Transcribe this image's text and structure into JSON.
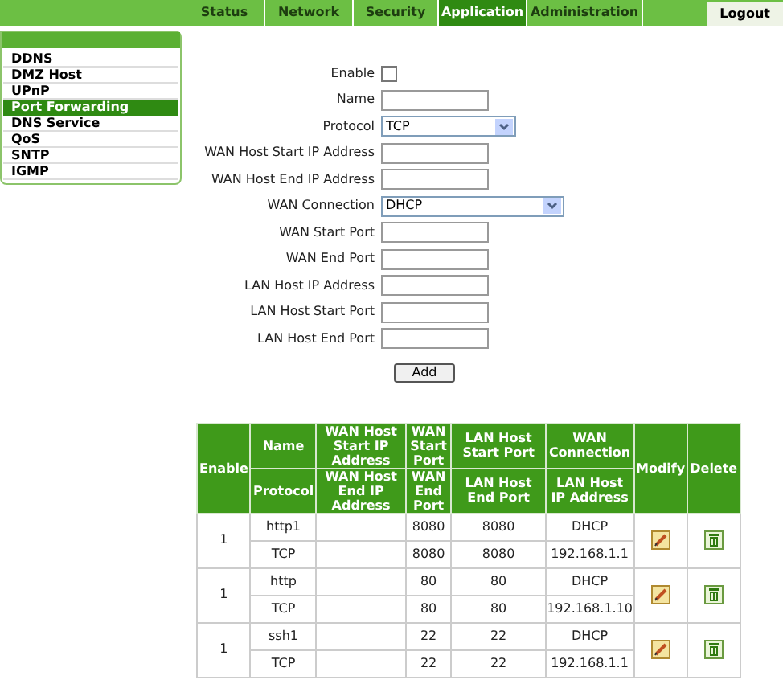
{
  "nav": {
    "tabs": [
      {
        "label": "Status",
        "selected": false
      },
      {
        "label": "Network",
        "selected": false
      },
      {
        "label": "Security",
        "selected": false
      },
      {
        "label": "Application",
        "selected": true
      },
      {
        "label": "Administration",
        "selected": false
      }
    ],
    "logout": "Logout"
  },
  "sidebar": {
    "items": [
      {
        "label": "DDNS",
        "selected": false
      },
      {
        "label": "DMZ Host",
        "selected": false
      },
      {
        "label": "UPnP",
        "selected": false
      },
      {
        "label": "Port Forwarding",
        "selected": true
      },
      {
        "label": "DNS Service",
        "selected": false
      },
      {
        "label": "QoS",
        "selected": false
      },
      {
        "label": "SNTP",
        "selected": false
      },
      {
        "label": "IGMP",
        "selected": false
      }
    ]
  },
  "form": {
    "fields": [
      {
        "kind": "checkbox",
        "label": "Enable",
        "checked": false
      },
      {
        "kind": "text",
        "label": "Name"
      },
      {
        "kind": "select",
        "label": "Protocol",
        "value": "TCP"
      },
      {
        "kind": "text",
        "label": "WAN Host Start IP Address"
      },
      {
        "kind": "text",
        "label": "WAN Host End IP Address"
      },
      {
        "kind": "select",
        "label": "WAN Connection",
        "value": "DHCP"
      },
      {
        "kind": "text",
        "label": "WAN Start Port"
      },
      {
        "kind": "text",
        "label": "WAN End Port"
      },
      {
        "kind": "text",
        "label": "LAN Host IP Address"
      },
      {
        "kind": "text",
        "label": "LAN Host Start Port"
      },
      {
        "kind": "text",
        "label": "LAN Host End Port"
      }
    ],
    "add_button": "Add"
  },
  "table": {
    "enable_header": "Enable",
    "top_headers": [
      "Name",
      "WAN Host Start IP Address",
      "WAN Start Port",
      "LAN Host Start Port",
      "WAN Connection"
    ],
    "bottom_headers": [
      "Protocol",
      "WAN Host End IP Address",
      "WAN End Port",
      "LAN Host End Port",
      "LAN Host IP Address"
    ],
    "modify_header": "Modify",
    "delete_header": "Delete",
    "rows": [
      {
        "enable": "1",
        "name": "http1",
        "protocol": "TCP",
        "wan_start_port": "8080",
        "wan_end_port": "8080",
        "lan_host_start_port": "8080",
        "lan_host_end_port": "8080",
        "wan_connection": "DHCP",
        "lan_host_ip": "192.168.1.1"
      },
      {
        "enable": "1",
        "name": "http",
        "protocol": "TCP",
        "wan_start_port": "80",
        "wan_end_port": "80",
        "lan_host_start_port": "80",
        "lan_host_end_port": "80",
        "wan_connection": "DHCP",
        "lan_host_ip": "192.168.1.10"
      },
      {
        "enable": "1",
        "name": "ssh1",
        "protocol": "TCP",
        "wan_start_port": "22",
        "wan_end_port": "22",
        "lan_host_start_port": "22",
        "lan_host_end_port": "22",
        "wan_connection": "DHCP",
        "lan_host_ip": "192.168.1.1"
      }
    ]
  }
}
